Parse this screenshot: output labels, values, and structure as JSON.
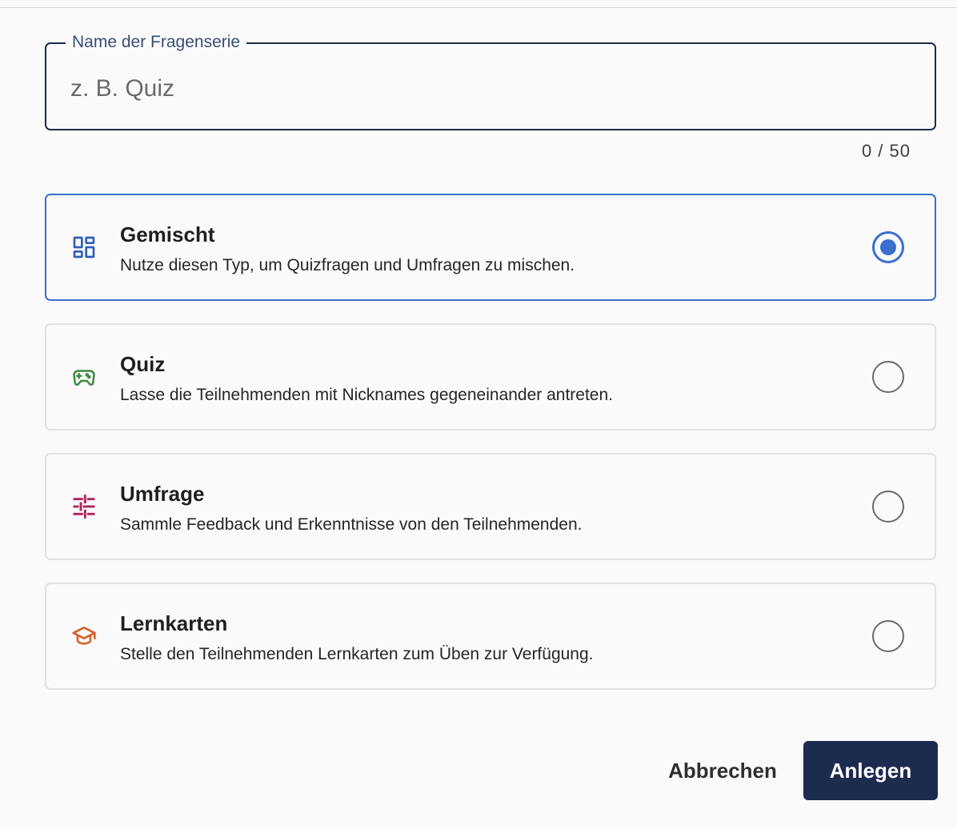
{
  "name_field": {
    "label": "Name der Fragenserie",
    "placeholder": "z. B. Quiz",
    "value": "",
    "counter": "0 / 50"
  },
  "options": [
    {
      "title": "Gemischt",
      "description": "Nutze diesen Typ, um Quizfragen und Umfragen zu mischen.",
      "icon": "dashboard-grid-icon",
      "icon_color": "#2f5fb8",
      "selected": true
    },
    {
      "title": "Quiz",
      "description": "Lasse die Teilnehmenden mit Nicknames gegeneinander antreten.",
      "icon": "gamepad-icon",
      "icon_color": "#3f8a3f",
      "selected": false
    },
    {
      "title": "Umfrage",
      "description": "Sammle Feedback und Erkenntnisse von den Teilnehmenden.",
      "icon": "sliders-icon",
      "icon_color": "#b0265f",
      "selected": false
    },
    {
      "title": "Lernkarten",
      "description": "Stelle den Teilnehmenden Lernkarten zum Üben zur Verfügung.",
      "icon": "graduation-cap-icon",
      "icon_color": "#d9622b",
      "selected": false
    }
  ],
  "actions": {
    "cancel_label": "Abbrechen",
    "create_label": "Anlegen"
  },
  "colors": {
    "accent": "#3a6fd0",
    "primary_button": "#1d2b4f",
    "field_border": "#1e2a4a"
  }
}
